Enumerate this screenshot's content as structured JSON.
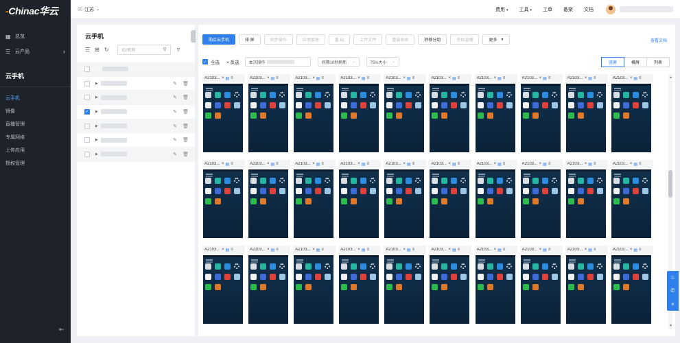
{
  "brand": {
    "logo_main": "Chinac",
    "logo_cn": "华云",
    "sub": ""
  },
  "header": {
    "region": "江苏",
    "links": [
      "费用",
      "工具",
      "工单",
      "备案",
      "文档"
    ]
  },
  "sidebar": {
    "top_items": [
      {
        "label": "总览",
        "icon": "grid-icon"
      },
      {
        "label": "云产品",
        "icon": "menu-icon"
      }
    ],
    "section_title": "云手机",
    "sub_items": [
      "云手机",
      "镜像",
      "直播管理",
      "专属网络",
      "上传应用",
      "授权管理"
    ],
    "active_sub": "云手机"
  },
  "tree": {
    "title": "云手机",
    "search_placeholder": "ID/名称",
    "rows": [
      {
        "checked": false
      },
      {
        "checked": false
      },
      {
        "checked": false
      },
      {
        "checked": true
      },
      {
        "checked": false
      },
      {
        "checked": false
      },
      {
        "checked": false
      }
    ]
  },
  "toolbar": {
    "buttons": [
      "购买云手机",
      "排 屏",
      "同步操作",
      "应用管理",
      "重 启",
      "上传文件",
      "重装系统",
      "转移分组",
      "开始直播",
      "更多"
    ],
    "doc_link": "查看文档"
  },
  "filterbar": {
    "select_all": "全选",
    "invert": "反选",
    "op_label": "本次操作",
    "refresh": "间隔10秒刷新",
    "scale": "75%大小",
    "view_tabs": [
      "竖屏",
      "横屏",
      "列表"
    ],
    "active_view": "竖屏"
  },
  "phone_card": {
    "name": "A2103..."
  },
  "colors": {
    "accent": "#2f80ed",
    "sidebar_bg": "#1e2329",
    "brand_orange": "#ff8a00"
  }
}
